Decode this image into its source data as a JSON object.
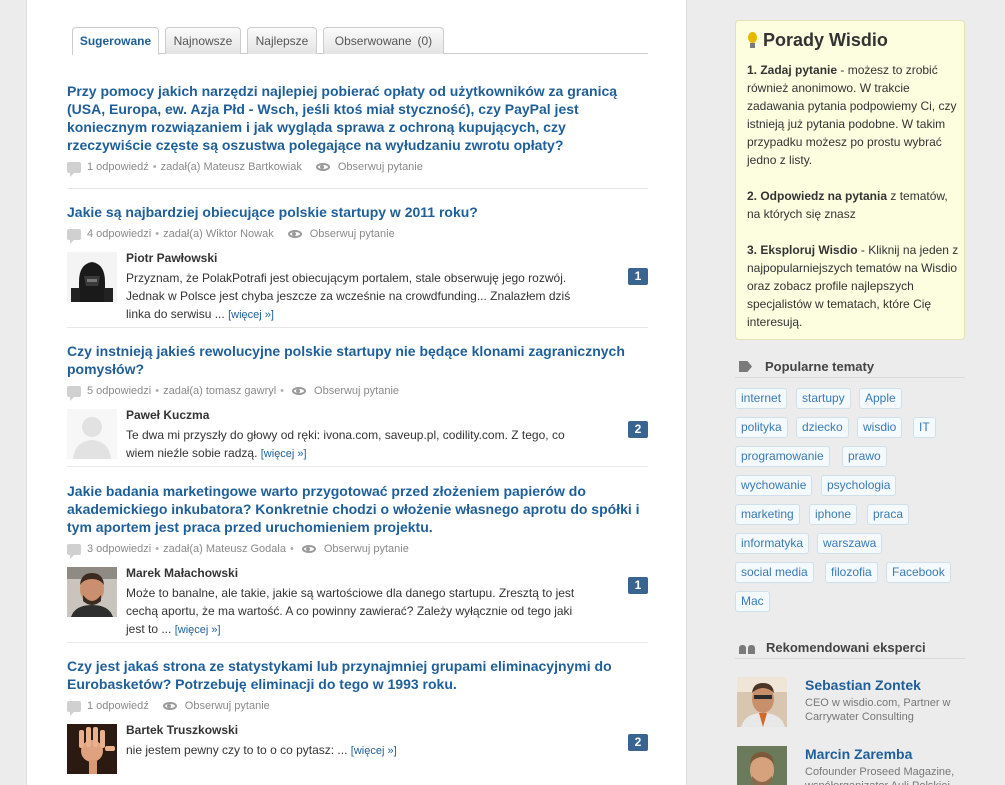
{
  "tabs": [
    {
      "label": "Sugerowane",
      "active": true
    },
    {
      "label": "Najnowsze"
    },
    {
      "label": "Najlepsze"
    },
    {
      "label": "Obserwowane",
      "count": "(0)"
    }
  ],
  "questions": [
    {
      "title": "Przy pomocy jakich narzędzi najlepiej pobierać opłaty od użytkowników za granicą (USA, Europa, ew. Azja Płd - Wsch, jeśli ktoś miał styczność), czy PayPal jest koniecznym rozwiązaniem i jak wygląda sprawa z ochroną kupujących, czy rzeczywiście częste są oszustwa polegające na wyłudzaniu zwrotu opłaty?",
      "answers_count": "1 odpowiedź",
      "asked_by": "zadał(a) Mateusz Bartkowiak",
      "follow": "Obserwuj pytanie"
    },
    {
      "title": "Jakie są najbardziej obiecujące polskie startupy w 2011 roku?",
      "answers_count": "4 odpowiedzi",
      "asked_by": "zadał(a) Wiktor Nowak",
      "follow": "Obserwuj pytanie",
      "answer": {
        "author": "Piotr Pawłowski",
        "text": "Przyznam, że PolakPotrafi jest obiecującym portalem, stale obserwuję jego rozwój. Jednak w Polsce jest chyba jeszcze za wcześnie na crowdfunding... Znalazłem dziś linka do serwisu ...",
        "more": "[więcej »]",
        "votes": "1"
      }
    },
    {
      "title": "Czy instnieją jakieś rewolucyjne polskie startupy nie będące klonami zagranicznych pomysłów?",
      "answers_count": "5 odpowiedzi",
      "asked_by": "zadał(a) tomasz gawryl",
      "follow": "Obserwuj pytanie",
      "answer": {
        "author": "Paweł Kuczma",
        "text": "Te dwa mi przyszły do głowy od ręki: ivona.com, saveup.pl, codility.com. Z tego, co wiem nieźle sobie radzą.",
        "more": "[więcej »]",
        "votes": "2"
      }
    },
    {
      "title": "Jakie badania marketingowe warto przygotować przed złożeniem papierów do akademickiego inkubatora? Konkretnie chodzi o włożenie własnego aprotu do spółki i tym aportem jest praca przed uruchomieniem projektu.",
      "answers_count": "3 odpowiedzi",
      "asked_by": "zadał(a) Mateusz Godala",
      "follow": "Obserwuj pytanie",
      "answer": {
        "author": "Marek Małachowski",
        "text": "Może to banalne, ale takie, jakie są wartościowe dla danego startupu. Zresztą to jest cechą aportu, że ma wartość. A co powinny zawierać? Zależy wyłącznie od tego jaki jest to ...",
        "more": "[więcej »]",
        "votes": "1"
      }
    },
    {
      "title": "Czy jest jakaś strona ze statystykami lub przynajmniej grupami eliminacyjnymi do Eurobasketów? Potrzebuję eliminacji do tego w 1993 roku.",
      "answers_count": "1 odpowiedź",
      "asked_by": "",
      "follow": "Obserwuj pytanie",
      "answer": {
        "author": "Bartek Truszkowski",
        "text": "nie jestem pewny czy to to o co pytasz: ...",
        "more": "[więcej »]",
        "votes": "2"
      }
    }
  ],
  "tips": {
    "title": "Porady Wisdio",
    "step1_bold": "1. Zadaj pytanie",
    "step1_text": " - możesz to zrobić również anonimowo. W trakcie zadawania pytania podpowiemy Ci, czy istnieją już pytania podobne. W takim przypadku możesz po prostu wybrać jedno z listy.",
    "step2_bold": "2. Odpowiedz na pytania",
    "step2_text": " z tematów, na których się znasz",
    "step3_bold": "3. Eksploruj Wisdio",
    "step3_text": " - Kliknij na jeden z najpopularniejszych tematów na Wisdio oraz zobacz profile najlepszych specjalistów w tematach, które Cię interesują."
  },
  "popular": {
    "heading": "Popularne tematy",
    "tags": [
      "internet",
      "startupy",
      "Apple",
      "polityka",
      "dziecko",
      "wisdio",
      "IT",
      "programowanie",
      "prawo",
      "wychowanie",
      "psychologia",
      "marketing",
      "iphone",
      "praca",
      "informatyka",
      "warszawa",
      "social media",
      "filozofia",
      "Facebook",
      "Mac"
    ]
  },
  "experts": {
    "heading": "Rekomendowani eksperci",
    "list": [
      {
        "name": "Sebastian Zontek",
        "desc": "CEO w wisdio.com, Partner w Carrywater Consulting"
      },
      {
        "name": "Marcin Zaremba",
        "desc": "Cofounder Proseed Magazine, współorganizator Auli Polskiej"
      }
    ]
  }
}
